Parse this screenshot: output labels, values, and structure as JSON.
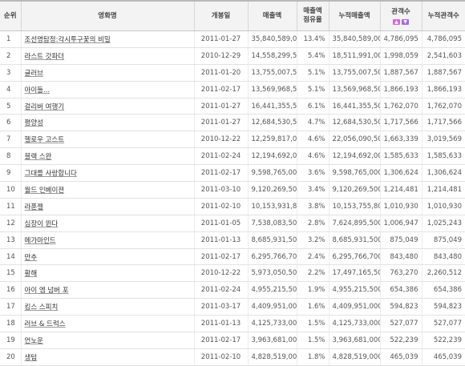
{
  "headers": {
    "rank": "순위",
    "title": "영화명",
    "release": "개봉일",
    "sales": "매출액",
    "share_line1": "매출액",
    "share_line2": "점유율",
    "cum_sales": "누적매출액",
    "audience": "관객수",
    "cum_audience": "누적관객수"
  },
  "sort_icons": {
    "up": "▲",
    "down": "▼"
  },
  "colors": {
    "sort_up": "#d26ad8",
    "sort_down": "#a56ad8"
  },
  "rows": [
    {
      "rank": "1",
      "title": "조선명탐정:각시투구꽃의 비밀",
      "release": "2011-01-27",
      "sales": "35,840,589,000",
      "share": "13.4%",
      "cum_sales": "35,840,589,000",
      "audience": "4,786,095",
      "cum_audience": "4,786,095"
    },
    {
      "rank": "2",
      "title": "라스트 갓파더",
      "release": "2010-12-29",
      "sales": "14,558,299,500",
      "share": "5.4%",
      "cum_sales": "18,511,991,000",
      "audience": "1,998,059",
      "cum_audience": "2,541,603"
    },
    {
      "rank": "3",
      "title": "글러브",
      "release": "2011-01-20",
      "sales": "13,755,007,500",
      "share": "5.1%",
      "cum_sales": "13,755,007,500",
      "audience": "1,887,567",
      "cum_audience": "1,887,567"
    },
    {
      "rank": "4",
      "title": "아이들...",
      "release": "2011-02-17",
      "sales": "13,569,968,500",
      "share": "5.1%",
      "cum_sales": "13,569,968,500",
      "audience": "1,866,193",
      "cum_audience": "1,866,193"
    },
    {
      "rank": "5",
      "title": "걸리버 여행기",
      "release": "2011-01-27",
      "sales": "16,441,355,500",
      "share": "6.1%",
      "cum_sales": "16,441,355,500",
      "audience": "1,762,070",
      "cum_audience": "1,762,070"
    },
    {
      "rank": "6",
      "title": "평양성",
      "release": "2011-01-27",
      "sales": "12,684,530,500",
      "share": "4.7%",
      "cum_sales": "12,684,530,500",
      "audience": "1,717,566",
      "cum_audience": "1,717,566"
    },
    {
      "rank": "7",
      "title": "헬로우 고스트",
      "release": "2010-12-22",
      "sales": "12,259,817,000",
      "share": "4.6%",
      "cum_sales": "22,056,090,500",
      "audience": "1,663,339",
      "cum_audience": "3,019,569"
    },
    {
      "rank": "8",
      "title": "블랙 스완",
      "release": "2011-02-24",
      "sales": "12,194,692,000",
      "share": "4.6%",
      "cum_sales": "12,194,692,000",
      "audience": "1,585,633",
      "cum_audience": "1,585,633"
    },
    {
      "rank": "9",
      "title": "그대를 사랑합니다",
      "release": "2011-02-17",
      "sales": "9,598,765,000",
      "share": "3.6%",
      "cum_sales": "9,598,765,000",
      "audience": "1,306,624",
      "cum_audience": "1,306,624"
    },
    {
      "rank": "10",
      "title": "월드 인베이젼",
      "release": "2011-03-10",
      "sales": "9,120,269,500",
      "share": "3.4%",
      "cum_sales": "9,120,269,500",
      "audience": "1,214,481",
      "cum_audience": "1,214,481"
    },
    {
      "rank": "11",
      "title": "라푼젤",
      "release": "2011-02-10",
      "sales": "10,153,931,800",
      "share": "3.8%",
      "cum_sales": "10,153,755,800",
      "audience": "1,010,930",
      "cum_audience": "1,010,930"
    },
    {
      "rank": "12",
      "title": "심장이 뛴다",
      "release": "2011-01-05",
      "sales": "7,538,083,500",
      "share": "2.8%",
      "cum_sales": "7,624,895,500",
      "audience": "1,006,947",
      "cum_audience": "1,025,243"
    },
    {
      "rank": "13",
      "title": "메가마인드",
      "release": "2011-01-13",
      "sales": "8,685,931,500",
      "share": "3.2%",
      "cum_sales": "8,685,931,500",
      "audience": "875,049",
      "cum_audience": "875,049"
    },
    {
      "rank": "14",
      "title": "만추",
      "release": "2011-02-17",
      "sales": "6,295,766,700",
      "share": "2.4%",
      "cum_sales": "6,295,766,700",
      "audience": "843,480",
      "cum_audience": "843,480"
    },
    {
      "rank": "15",
      "title": "황해",
      "release": "2010-12-22",
      "sales": "5,973,050,500",
      "share": "2.2%",
      "cum_sales": "17,497,165,500",
      "audience": "763,270",
      "cum_audience": "2,260,512"
    },
    {
      "rank": "16",
      "title": "아이 엠 넘버 포",
      "release": "2011-02-24",
      "sales": "4,955,215,500",
      "share": "1.9%",
      "cum_sales": "4,955,215,500",
      "audience": "654,386",
      "cum_audience": "654,386"
    },
    {
      "rank": "17",
      "title": "킹스 스피치",
      "release": "2011-03-17",
      "sales": "4,409,951,000",
      "share": "1.6%",
      "cum_sales": "4,409,951,000",
      "audience": "594,823",
      "cum_audience": "594,823"
    },
    {
      "rank": "18",
      "title": "러브 & 드럭스",
      "release": "2011-01-13",
      "sales": "4,125,733,000",
      "share": "1.5%",
      "cum_sales": "4,125,733,000",
      "audience": "527,077",
      "cum_audience": "527,077"
    },
    {
      "rank": "19",
      "title": "언노운",
      "release": "2011-02-17",
      "sales": "3,963,681,000",
      "share": "1.5%",
      "cum_sales": "3,963,681,000",
      "audience": "522,239",
      "cum_audience": "522,239"
    },
    {
      "rank": "20",
      "title": "생텀",
      "release": "2011-02-10",
      "sales": "4,828,519,000",
      "share": "1.8%",
      "cum_sales": "4,828,519,000",
      "audience": "465,039",
      "cum_audience": "465,039"
    }
  ]
}
